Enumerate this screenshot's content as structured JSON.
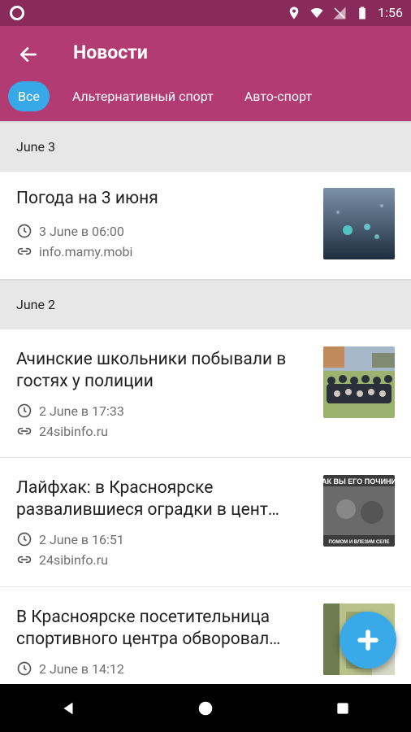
{
  "status_bar": {
    "time": "1:56"
  },
  "appbar": {
    "title": "Новости"
  },
  "tabs": [
    {
      "label": "Все"
    },
    {
      "label": "Альтернативный спорт"
    },
    {
      "label": "Авто-спорт"
    }
  ],
  "sections": [
    {
      "date": "June 3",
      "items": [
        {
          "title": "Погода на 3 июня",
          "time": "3 June в 06:00",
          "source": "info.mamy.mobi"
        }
      ]
    },
    {
      "date": "June 2",
      "items": [
        {
          "title": "Ачинские школьники побывали в гостях у полиции",
          "time": "2 June в 17:33",
          "source": "24sibinfo.ru"
        },
        {
          "title": "Лайфхак: в Красноярске развалившиеся оградки в цент…",
          "time": "2 June в 16:51",
          "source": "24sibinfo.ru"
        },
        {
          "title": "В Красноярске посетительница спортивного центра обворовал…",
          "time": "2 June в 14:12",
          "source": ""
        }
      ]
    }
  ],
  "thumb_text": {
    "meme_top": "АК ВЫ ЕГО ПОЧИНИ",
    "meme_bottom": "ПОМОМ И ВЛЕЗИМ СЕЛЕ"
  }
}
